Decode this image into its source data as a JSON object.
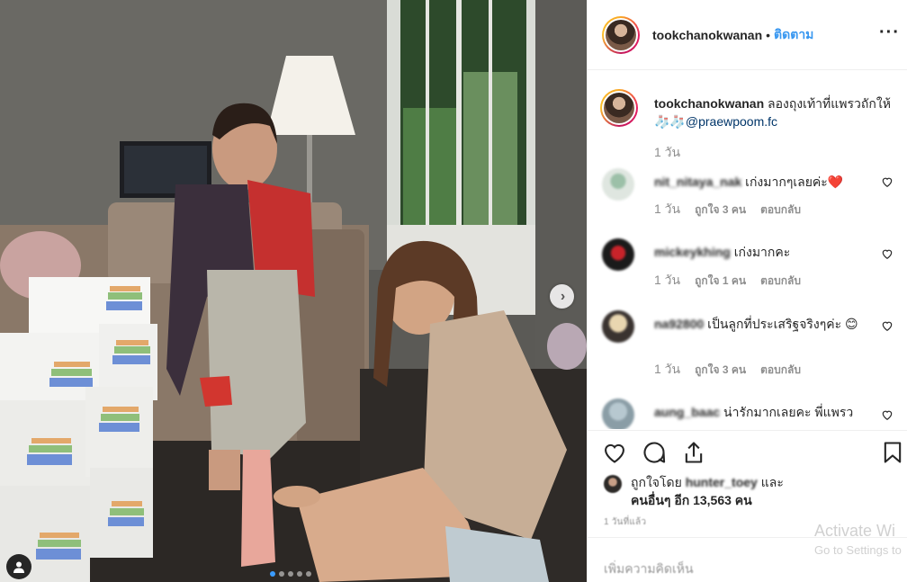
{
  "post": {
    "username": "tookchanokwanan",
    "separator": "•",
    "follow_label": "ติดตาม",
    "more_icon": "more-horizontal-icon",
    "caption_text": "ลองถุงเท้าที่แพรวถักให้ 🧦🧦",
    "caption_mention": "@praewpoom.fc",
    "caption_time": "1 วัน"
  },
  "comments": [
    {
      "user": "nit_nitaya_nak",
      "text": "เก่งมากๆเลยค่ะ❤️",
      "time": "1 วัน",
      "likes": "ถูกใจ 3 คน",
      "reply": "ตอบกลับ"
    },
    {
      "user": "mickeykhing",
      "text": "เก่งมากคะ",
      "time": "1 วัน",
      "likes": "ถูกใจ 1 คน",
      "reply": "ตอบกลับ"
    },
    {
      "user": "na92800",
      "text": "เป็นลูกที่ประเสริฐจริงๆค่ะ 😊",
      "time": "1 วัน",
      "likes": "ถูกใจ 3 คน",
      "reply": "ตอบกลับ"
    },
    {
      "user": "aung_baac",
      "text": "น่ารักมากเลยคะ พี่แพรว",
      "time": "",
      "likes": "",
      "reply": ""
    }
  ],
  "likes": {
    "prefix": "ถูกใจโดย",
    "user": "hunter_toey",
    "and": "และ",
    "others": "คนอื่นๆ อีก 13,563 คน"
  },
  "post_age": "1 วันที่แล้ว",
  "add_comment_placeholder": "เพิ่มความคิดเห็น",
  "watermark": {
    "line1": "Activate Wi",
    "line2": "Go to Settings to"
  },
  "carousel": {
    "total": 5,
    "current": 1
  },
  "colors": {
    "link": "#3897f0",
    "mention": "#003569",
    "dot_active": "#3b9cff"
  }
}
